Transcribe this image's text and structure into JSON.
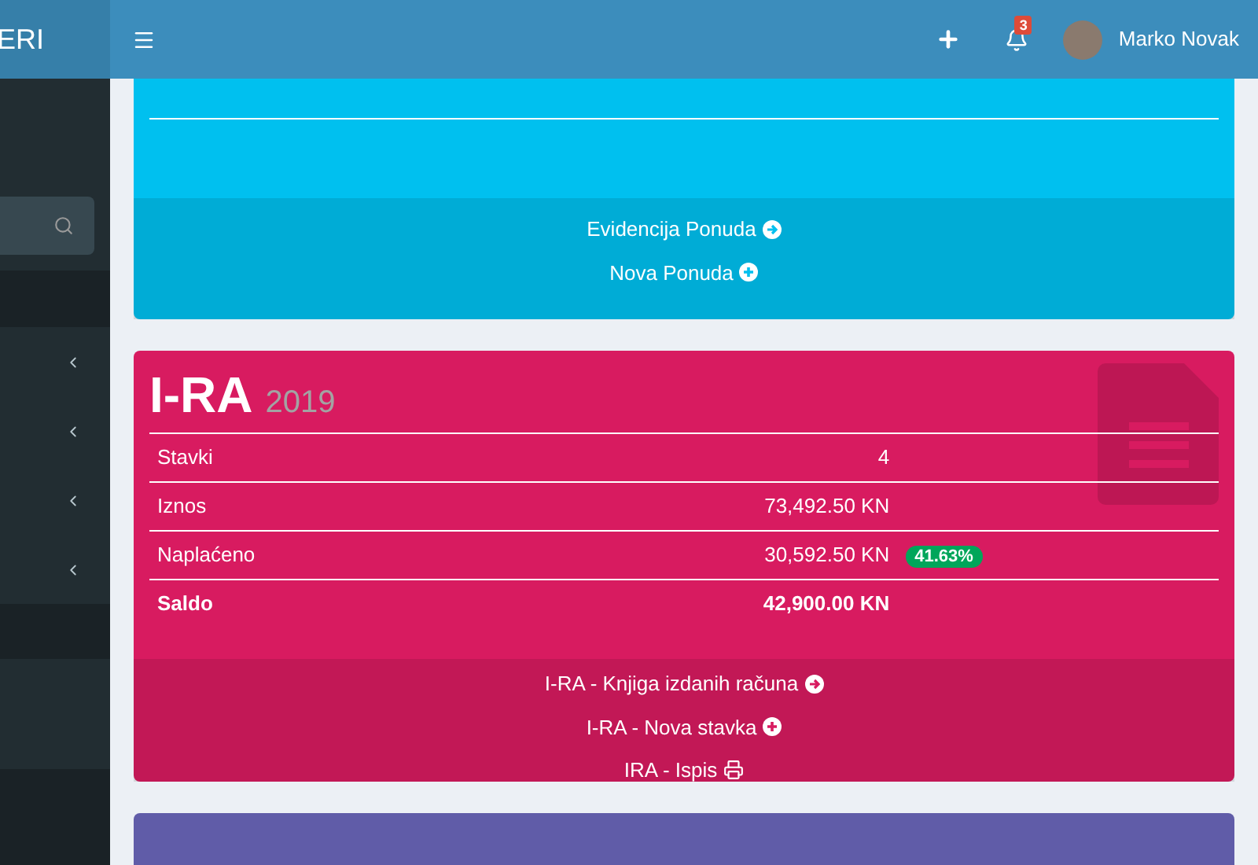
{
  "header": {
    "logo": "ERI",
    "notifications_count": "3",
    "user_name": "Marko Novak"
  },
  "cards": [
    {
      "kind": "links",
      "color": "#00c0ef",
      "links": [
        {
          "label": "Evidencija Ponuda",
          "kind": "arrow"
        },
        {
          "label": "Nova Ponuda",
          "kind": "plus"
        }
      ]
    },
    {
      "kind": "stats",
      "color": "#d81b60",
      "title": "I-RA",
      "year": "2019",
      "rows": [
        {
          "label": "Stavki",
          "value": "4",
          "bold": false
        },
        {
          "label": "Iznos",
          "value": "73,492.50 KN",
          "bold": false
        },
        {
          "label": "Naplaćeno",
          "value": "30,592.50 KN",
          "bold": false,
          "badge": "41.63%"
        },
        {
          "label": "Saldo",
          "value": "42,900.00 KN",
          "bold": true
        }
      ],
      "links": [
        {
          "label": "I-RA - Knjiga izdanih računa",
          "kind": "arrow"
        },
        {
          "label": "I-RA - Nova stavka",
          "kind": "plus"
        },
        {
          "label": "IRA - Ispis",
          "kind": "print"
        }
      ]
    },
    {
      "kind": "stub",
      "color": "#605ca8"
    }
  ]
}
